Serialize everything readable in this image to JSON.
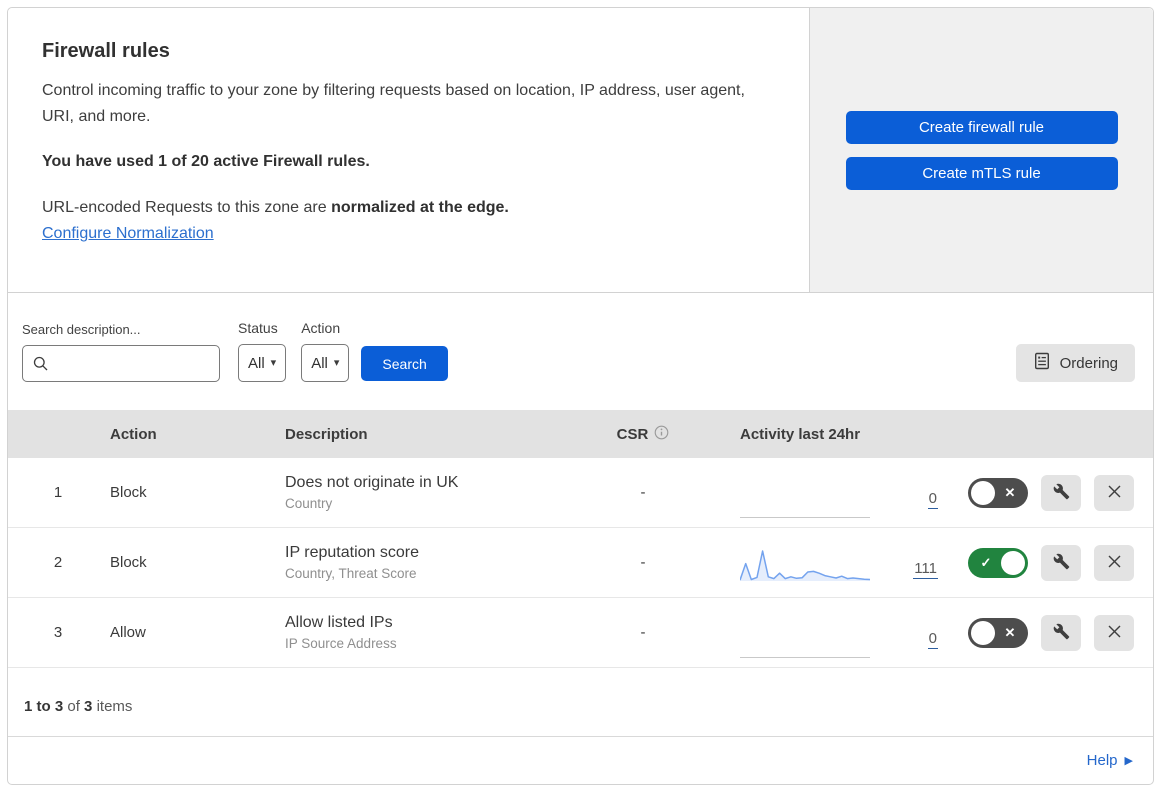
{
  "colors": {
    "button_blue": "#0b5ed7",
    "link_blue": "#2c6fce",
    "toggle_on_green": "#21843f",
    "toggle_off_gray": "#4d4d4d",
    "sparkline_blue": "#74a3ee",
    "table_header_bg": "#e2e2e2",
    "cta_panel_bg": "#f0f0f0"
  },
  "icons": {
    "dropdown_caret": "▾",
    "help_arrow": "▶",
    "toggle_on_mark": "✓",
    "toggle_off_mark": "✕"
  },
  "intro": {
    "title": "Firewall rules",
    "description": "Control incoming traffic to your zone by filtering requests based on location, IP address, user agent, URI, and more.",
    "usage": "You have used 1 of 20 active Firewall rules.",
    "normalization_prefix": "URL-encoded Requests to this zone are ",
    "normalization_bold": "normalized at the edge.",
    "normalization_link": "Configure Normalization"
  },
  "cta": {
    "buttons": [
      {
        "label": "Create firewall rule"
      },
      {
        "label": "Create mTLS rule"
      }
    ]
  },
  "filters": {
    "search_label": "Search description...",
    "search_value": "",
    "status_label": "Status",
    "status_value": "All",
    "action_label": "Action",
    "action_value": "All",
    "search_button_label": "Search",
    "ordering_button_label": "Ordering"
  },
  "table": {
    "headers": {
      "action": "Action",
      "description": "Description",
      "csr": "CSR",
      "activity": "Activity last 24hr"
    },
    "rows": [
      {
        "num": "1",
        "action": "Block",
        "description": "Does not originate in UK",
        "criteria": "Country",
        "csr": "-",
        "activity_count": "0",
        "enabled": false
      },
      {
        "num": "2",
        "action": "Block",
        "description": "IP reputation score",
        "criteria": "Country, Threat Score",
        "csr": "-",
        "activity_count": "111",
        "enabled": true,
        "sparkline": [
          3,
          58,
          5,
          12,
          100,
          14,
          8,
          26,
          8,
          14,
          9,
          11,
          30,
          32,
          26,
          18,
          14,
          10,
          16,
          8,
          10,
          8,
          6,
          5
        ]
      },
      {
        "num": "3",
        "action": "Allow",
        "description": "Allow listed IPs",
        "criteria": "IP Source Address",
        "csr": "-",
        "activity_count": "0",
        "enabled": false
      }
    ]
  },
  "footer": {
    "range": "1 to 3",
    "of_label": "of",
    "total": "3",
    "items_label": "items",
    "help_label": "Help"
  }
}
